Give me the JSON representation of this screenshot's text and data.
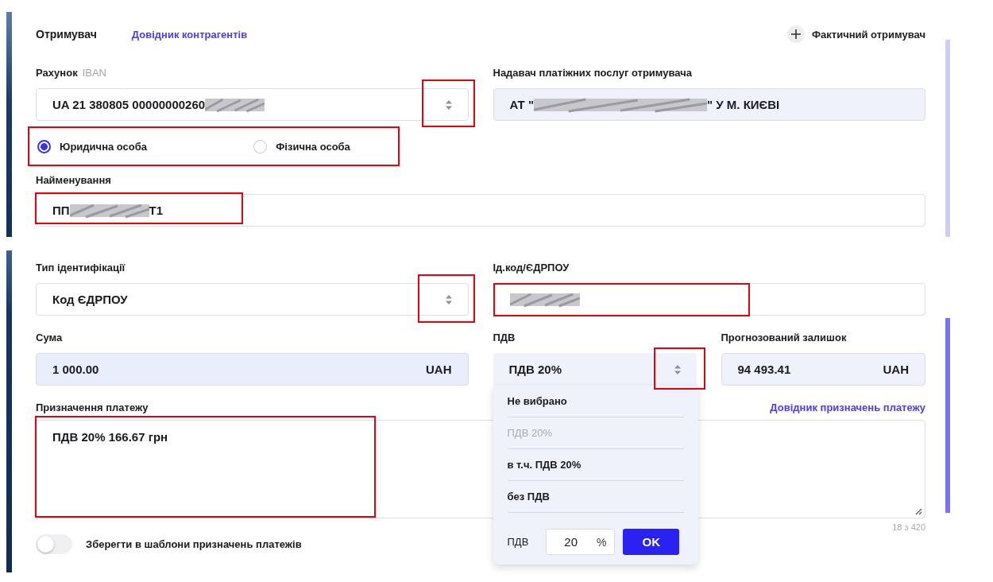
{
  "recipient": {
    "title": "Отримувач",
    "directory_link": "Довідник контрагентів",
    "actual_recipient_button": "Фактичний отримувач"
  },
  "account": {
    "label": "Рахунок",
    "hint": "IBAN",
    "value": "UA 21 380805 00000000260",
    "redacted": true,
    "stepper_highlighted": true
  },
  "provider": {
    "label": "Надавач платіжних послуг отримувача",
    "value_before": "АТ \"",
    "value_after": "\" У М. КИЄВІ",
    "redacted": true
  },
  "entity_types": {
    "highlighted": true,
    "options": [
      {
        "label": "Юридична особа",
        "selected": true
      },
      {
        "label": "Фізична особа",
        "selected": false
      }
    ]
  },
  "name": {
    "label": "Найменування",
    "value_before": "ПП",
    "value_after": "Т1",
    "redacted": true,
    "highlighted": true
  },
  "id_type": {
    "label": "Тип ідентифікації",
    "value": "Код ЄДРПОУ",
    "stepper_highlighted": true
  },
  "id_code": {
    "label": "Ід.код/ЄДРПОУ",
    "redacted": true,
    "highlighted": true
  },
  "amount": {
    "label": "Сума",
    "value": "1 000.00",
    "currency": "UAH"
  },
  "vat": {
    "label": "ПДВ",
    "value": "ПДВ 20%",
    "stepper_highlighted": true,
    "expanded": true,
    "options": [
      {
        "label": "Не вибрано",
        "disabled": false
      },
      {
        "label": "ПДВ 20%",
        "disabled": true
      },
      {
        "label": "в т.ч. ПДВ 20%",
        "disabled": false
      },
      {
        "label": "без ПДВ",
        "disabled": false
      }
    ],
    "rate_label": "ПДВ",
    "rate": "20",
    "rate_unit": "%",
    "ok": "OK"
  },
  "balance": {
    "label": "Прогнозований залишок",
    "value": "94 493.41",
    "currency": "UAH"
  },
  "purpose": {
    "label": "Призначення платежу",
    "directory_link": "Довідник призначень платежу",
    "value": "ПДВ 20% 166.67 грн",
    "counter": "18 з 420",
    "highlighted": true
  },
  "save_template": {
    "label": "Зберегти в шаблони призначень платежів",
    "on": false
  }
}
